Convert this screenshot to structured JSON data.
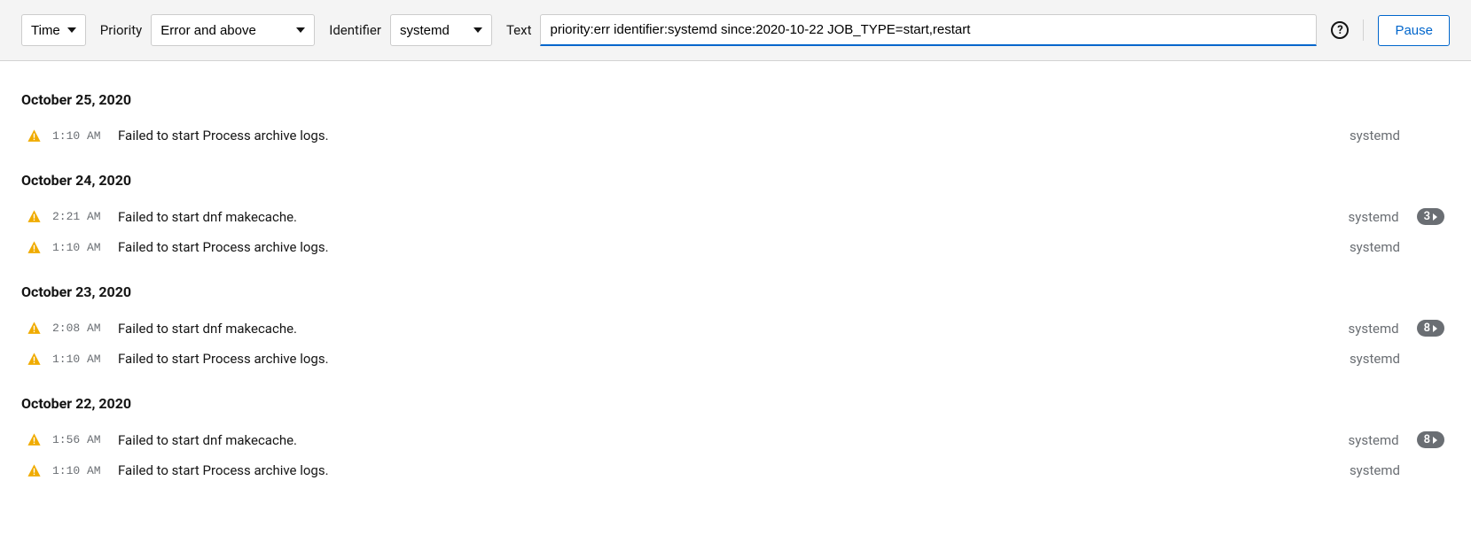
{
  "toolbar": {
    "time_label": "Time",
    "priority_label": "Priority",
    "priority_value": "Error and above",
    "identifier_label": "Identifier",
    "identifier_value": "systemd",
    "text_label": "Text",
    "text_value": "priority:err identifier:systemd since:2020-10-22 JOB_TYPE=start,restart ",
    "help_glyph": "?",
    "pause_label": "Pause"
  },
  "groups": [
    {
      "date": "October 25, 2020",
      "entries": [
        {
          "time": "1:10 AM",
          "message": "Failed to start Process archive logs.",
          "identifier": "systemd",
          "badge": null
        }
      ]
    },
    {
      "date": "October 24, 2020",
      "entries": [
        {
          "time": "2:21 AM",
          "message": "Failed to start dnf makecache.",
          "identifier": "systemd",
          "badge": "3"
        },
        {
          "time": "1:10 AM",
          "message": "Failed to start Process archive logs.",
          "identifier": "systemd",
          "badge": null
        }
      ]
    },
    {
      "date": "October 23, 2020",
      "entries": [
        {
          "time": "2:08 AM",
          "message": "Failed to start dnf makecache.",
          "identifier": "systemd",
          "badge": "8"
        },
        {
          "time": "1:10 AM",
          "message": "Failed to start Process archive logs.",
          "identifier": "systemd",
          "badge": null
        }
      ]
    },
    {
      "date": "October 22, 2020",
      "entries": [
        {
          "time": "1:56 AM",
          "message": "Failed to start dnf makecache.",
          "identifier": "systemd",
          "badge": "8"
        },
        {
          "time": "1:10 AM",
          "message": "Failed to start Process archive logs.",
          "identifier": "systemd",
          "badge": null
        }
      ]
    }
  ]
}
